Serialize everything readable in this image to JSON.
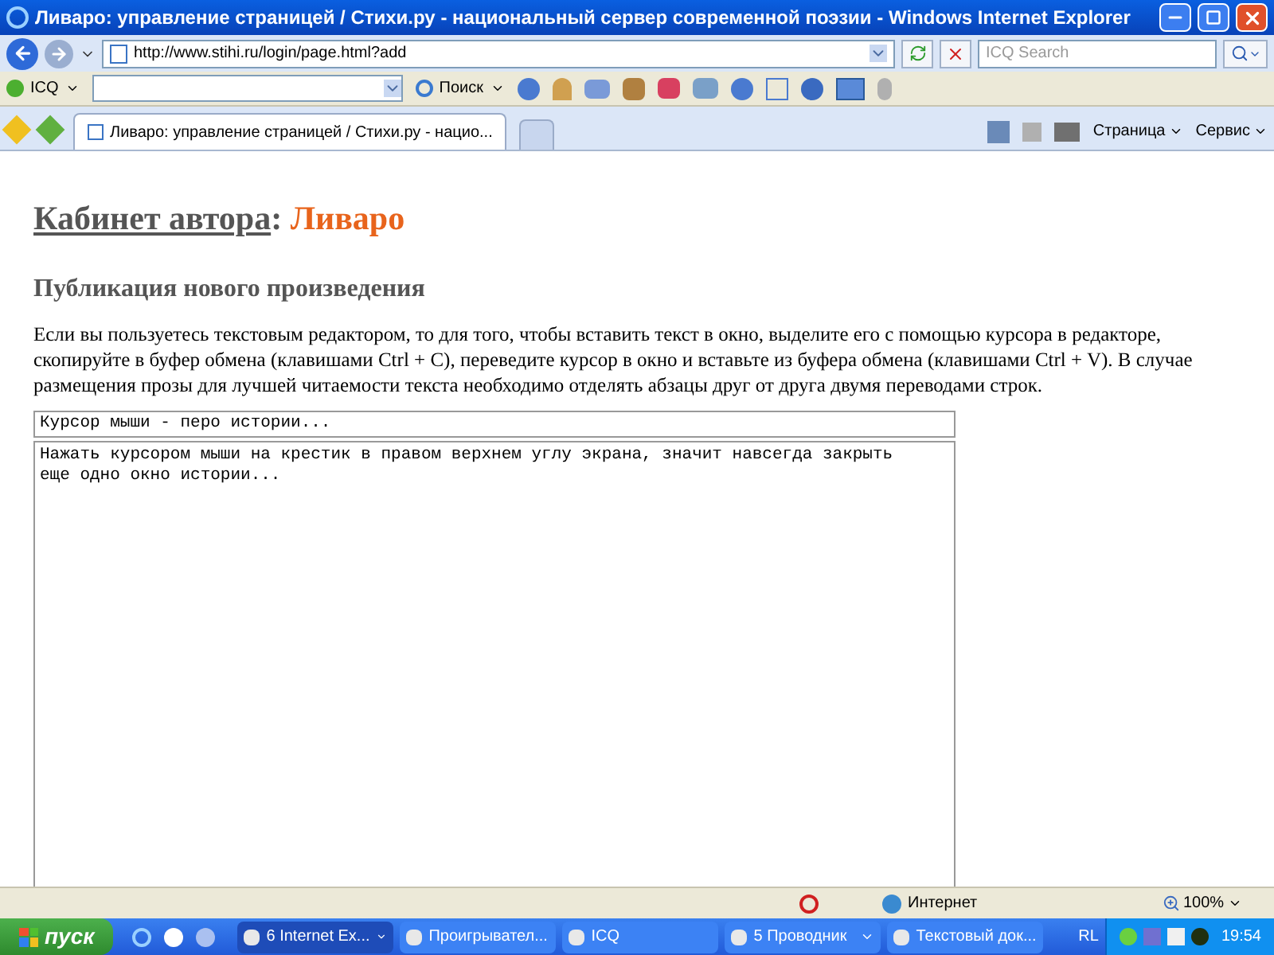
{
  "window": {
    "title": "Ливаро: управление страницей / Стихи.ру - национальный сервер современной поэзии - Windows Internet Explorer"
  },
  "address_bar": {
    "url": "http://www.stihi.ru/login/page.html?add",
    "search_placeholder": "ICQ Search"
  },
  "icq_toolbar": {
    "label": "ICQ",
    "search_button": "Поиск"
  },
  "tabs": [
    {
      "label": "Ливаро: управление страницей / Стихи.ру - нацио...",
      "selected": true
    }
  ],
  "command_bar": {
    "items": [
      "Страница",
      "Сервис"
    ]
  },
  "page": {
    "heading_link": "Кабинет автора",
    "heading_sep": ":",
    "author": "Ливаро",
    "subheading": "Публикация нового произведения",
    "instructions": "Если вы пользуетесь текстовым редактором, то для того, чтобы вставить текст в окно, выделите его с помощью курсора в редакторе, скопируйте в буфер обмена (клавишами Ctrl + C), переведите курсор в окно и вставьте из буфера обмена (клавишами Ctrl + V). В случае размещения прозы для лучшей читаемости текста необходимо отделять абзацы друг от друга двумя переводами строк.",
    "title_field": {
      "value": "Курсор мыши - перо истории..."
    },
    "text_field": {
      "value": "Нажать курсором мыши на крестик в правом верхнем углу экрана, значит навсегда закрыть еще одно окно истории..."
    }
  },
  "status_bar": {
    "zone": "Интернет",
    "zoom": "100%"
  },
  "taskbar": {
    "start": "пуск",
    "buttons": [
      {
        "label": "6 Internet Ex...",
        "kind": "group",
        "selected": true
      },
      {
        "label": "Проигрывател...",
        "kind": "single",
        "selected": false
      },
      {
        "label": "ICQ",
        "kind": "single",
        "selected": false
      },
      {
        "label": "5 Проводник",
        "kind": "group",
        "selected": false
      },
      {
        "label": "Текстовый док...",
        "kind": "single",
        "selected": false
      }
    ],
    "language": "RL",
    "time": "19:54"
  }
}
